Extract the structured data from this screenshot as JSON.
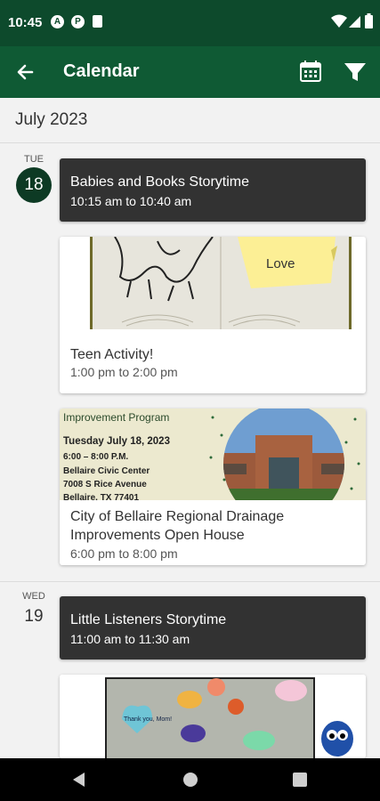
{
  "status": {
    "time": "10:45",
    "icons": [
      "a-icon",
      "p-icon",
      "sim-icon",
      "wifi-icon",
      "signal-icon",
      "battery-icon"
    ]
  },
  "appbar": {
    "title": "Calendar",
    "icons": [
      "back-arrow-icon",
      "calendar-icon",
      "filter-icon"
    ]
  },
  "month": "July 2023",
  "days": [
    {
      "dow": "TUE",
      "day": "18",
      "events": [
        {
          "title": "Babies and Books Storytime",
          "time": "10:15 am to 10:40 am"
        },
        {
          "title": "Teen Activity!",
          "time": "1:00 pm to 2:00 pm",
          "image_text": "Love"
        },
        {
          "title_line1": "City of Bellaire Regional Drainage",
          "title_line2": "Improvements Open House",
          "time": "6:00 pm to 8:00 pm",
          "image": {
            "heading": "Improvement Program",
            "line1": "Tuesday July 18, 2023",
            "line2": "6:00 – 8:00 P.M.",
            "line3": "Bellaire Civic Center",
            "line4": "7008 S Rice Avenue",
            "line5": "Bellaire, TX 77401"
          }
        }
      ]
    },
    {
      "dow": "WED",
      "day": "19",
      "events": [
        {
          "title": "Little Listeners Storytime",
          "time": "11:00 am to 11:30 am"
        },
        {
          "image_text": "Thank you, Mom!"
        }
      ]
    }
  ],
  "colors": {
    "statusbar": "#0d4a2c",
    "appbar": "#0f5a34",
    "dark_card": "#323232",
    "day_circle": "#0d3a24"
  }
}
